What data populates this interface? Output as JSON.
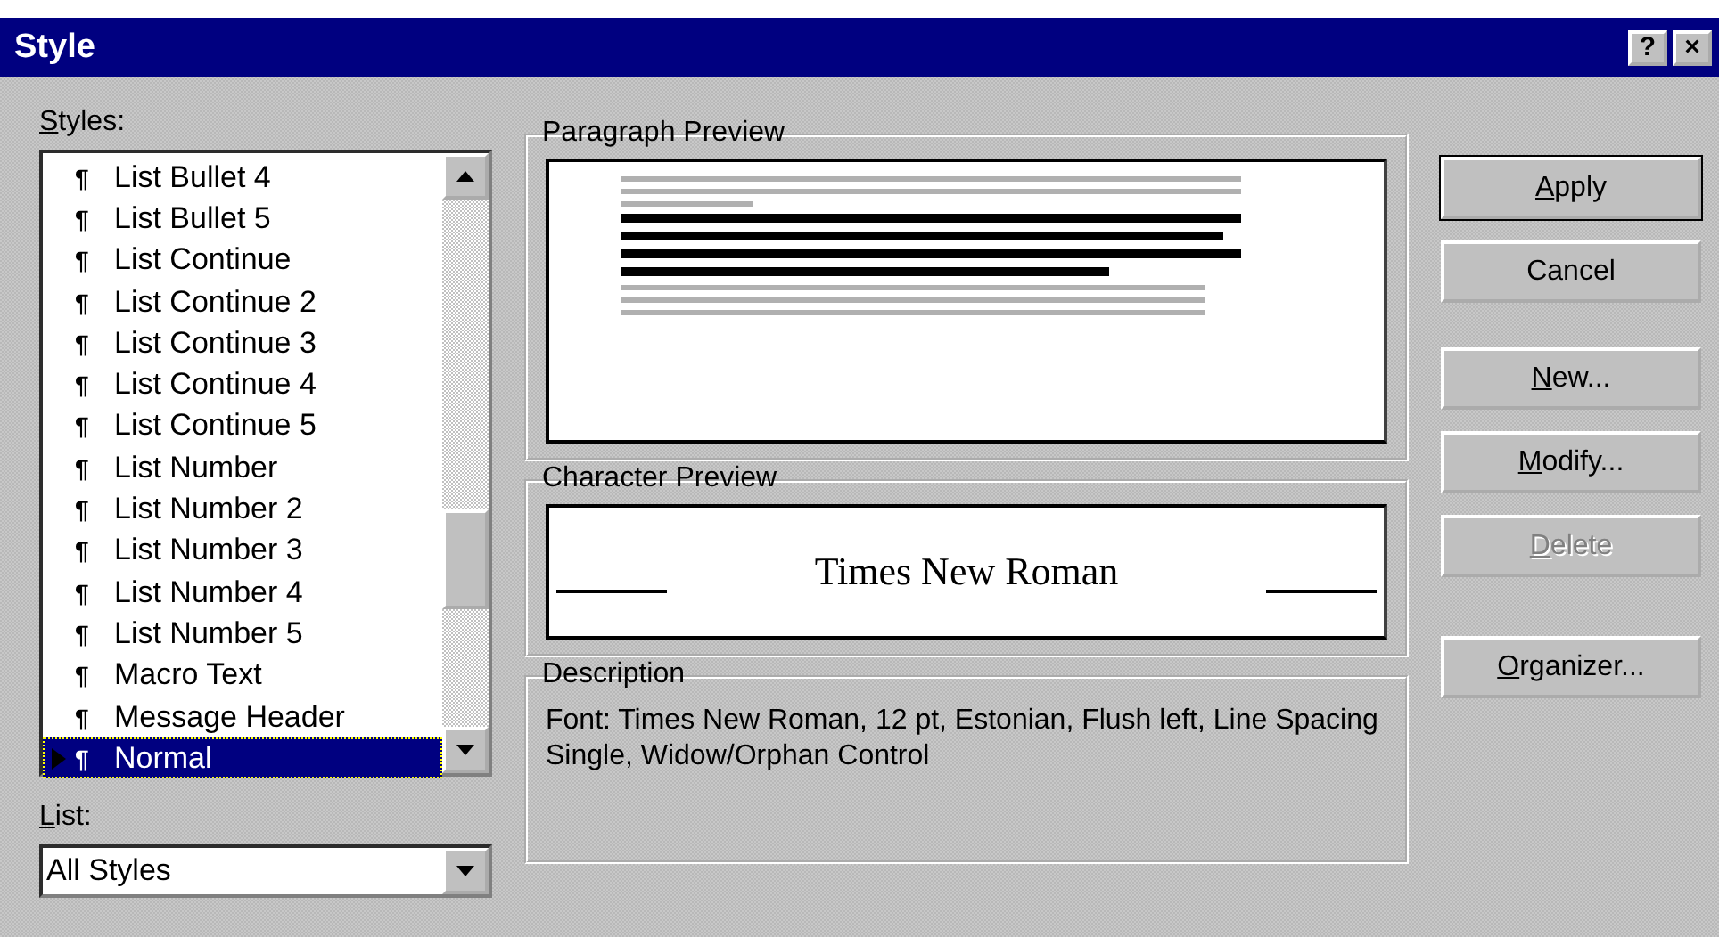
{
  "window": {
    "title": "Style",
    "help_button": "?",
    "close_button": "×"
  },
  "styles_label": {
    "text": "Styles:",
    "first_letter_underlined": true
  },
  "styles": [
    {
      "mark": "¶",
      "name": "List Bullet 4",
      "selected": false
    },
    {
      "mark": "¶",
      "name": "List Bullet 5",
      "selected": false
    },
    {
      "mark": "¶",
      "name": "List Continue",
      "selected": false
    },
    {
      "mark": "¶",
      "name": "List Continue 2",
      "selected": false
    },
    {
      "mark": "¶",
      "name": "List Continue 3",
      "selected": false
    },
    {
      "mark": "¶",
      "name": "List Continue 4",
      "selected": false
    },
    {
      "mark": "¶",
      "name": "List Continue 5",
      "selected": false
    },
    {
      "mark": "¶",
      "name": "List Number",
      "selected": false
    },
    {
      "mark": "¶",
      "name": "List Number 2",
      "selected": false
    },
    {
      "mark": "¶",
      "name": "List Number 3",
      "selected": false
    },
    {
      "mark": "¶",
      "name": "List Number 4",
      "selected": false
    },
    {
      "mark": "¶",
      "name": "List Number 5",
      "selected": false
    },
    {
      "mark": "¶",
      "name": "Macro Text",
      "selected": false
    },
    {
      "mark": "¶",
      "name": "Message Header",
      "selected": false
    },
    {
      "mark": "¶",
      "name": "Normal",
      "selected": true
    }
  ],
  "list_label": {
    "text": "List:",
    "first_letter_underlined": true
  },
  "list_dropdown": {
    "value": "All Styles"
  },
  "paragraph_preview": {
    "title": "Paragraph Preview"
  },
  "character_preview": {
    "title": "Character Preview",
    "sample": "Times New Roman"
  },
  "description": {
    "title": "Description",
    "text": "Font: Times New Roman, 12 pt, Estonian, Flush left, Line Spacing Single, Widow/Orphan Control"
  },
  "button_groups": [
    [
      {
        "label": "Apply",
        "first_letter_underlined": true,
        "default": true,
        "disabled": false
      },
      {
        "label": "Cancel",
        "first_letter_underlined": false,
        "default": false,
        "disabled": false
      }
    ],
    [
      {
        "label": "New...",
        "first_letter_underlined": true,
        "default": false,
        "disabled": false
      },
      {
        "label": "Modify...",
        "first_letter_underlined": true,
        "default": false,
        "disabled": false
      },
      {
        "label": "Delete",
        "first_letter_underlined": true,
        "default": false,
        "disabled": true
      }
    ],
    [
      {
        "label": "Organizer...",
        "first_letter_underlined": true,
        "default": false,
        "disabled": false
      }
    ]
  ]
}
